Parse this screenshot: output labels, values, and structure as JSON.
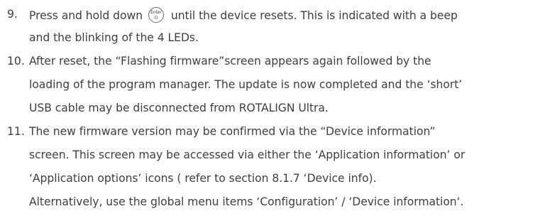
{
  "steps": [
    {
      "number": "9.",
      "line1_before": "Press and hold down",
      "key_icon": {
        "top_label": "Enter",
        "bottom_label": "⊙"
      },
      "line1_after": "until the device resets. This is indicated with a beep",
      "line2": "and the blinking of the 4 LEDs."
    },
    {
      "number": "10.",
      "lines": [
        "After reset, the “Flashing firmware”screen appears again followed by the",
        "loading of the program manager. The update is now completed and the ‘short’",
        "USB cable may be disconnected from ROTALIGN Ultra."
      ]
    },
    {
      "number": "11.",
      "lines": [
        "The new firmware version may be confirmed via the “Device information”",
        "screen. This screen may be accessed via either the ‘Application information’ or",
        "‘Application options’ icons ( refer to section 8.1.7 ‘Device info).",
        "Alternatively, use the global menu items ‘Configuration’ / ‘Device information‘."
      ]
    }
  ]
}
